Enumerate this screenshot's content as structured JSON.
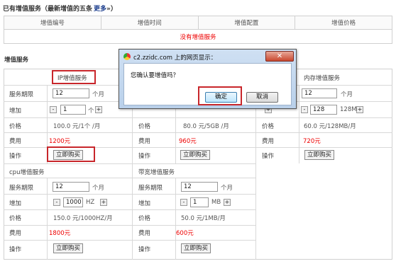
{
  "top": {
    "title": "已有增值服务（最新增值的五条",
    "more": "更多",
    "more_suffix": "»）",
    "table": {
      "headers": [
        "增值编号",
        "增值时间",
        "增值配置",
        "增值价格"
      ],
      "empty_text": "没有增值服务"
    }
  },
  "services_title": "增值服务",
  "cards": {
    "ip": {
      "title": "IP增值服务",
      "period_label": "服务期限",
      "period_value": "12",
      "period_unit": "个月",
      "add_label": "增加",
      "add_value": "1",
      "add_unit": "个",
      "price_label": "价格",
      "price_value": "100.0 元/1个 /月",
      "fee_label": "费用",
      "fee_value": "1200元",
      "op_label": "操作",
      "buy": "立即购买"
    },
    "disk": {
      "title": "",
      "period_label": "",
      "add_label": "",
      "price_label": "价格",
      "price_value": "80.0 元/5GB /月",
      "fee_label": "费用",
      "fee_value": "960元",
      "op_label": "操作",
      "buy": "立即购买"
    },
    "mem": {
      "title": "内存增值服务",
      "period_value": "12",
      "period_unit": "个月",
      "add_value": "128",
      "add_unit": "128MB",
      "price_label": "价格",
      "price_value": "60.0 元/128MB/月",
      "fee_label": "费用",
      "fee_value": "720元",
      "op_label": "操作",
      "buy": "立即购买"
    },
    "cpu": {
      "title": "cpu增值服务",
      "period_label": "服务期限",
      "period_value": "12",
      "period_unit": "个月",
      "add_label": "增加",
      "add_value": "1000",
      "add_unit": "HZ",
      "price_label": "价格",
      "price_value": "150.0 元/1000HZ/月",
      "fee_label": "费用",
      "fee_value": "1800元",
      "op_label": "操作",
      "buy": "立即购买"
    },
    "bw": {
      "title": "带宽增值服务",
      "period_label": "服务期限",
      "period_value": "12",
      "period_unit": "个月",
      "add_label": "增加",
      "add_value": "1",
      "add_unit": "MB",
      "price_label": "价格",
      "price_value": "50.0 元/1MB/月",
      "fee_label": "费用",
      "fee_value": "600元",
      "op_label": "操作",
      "buy": "立即购买"
    }
  },
  "dialog": {
    "caption": "c2.zzidc.com 上的网页显示：",
    "close": "✕",
    "message": "您确认要增值吗？",
    "ok": "确定",
    "cancel": "取消"
  },
  "icons": {
    "minus": "-",
    "plus": "+"
  }
}
